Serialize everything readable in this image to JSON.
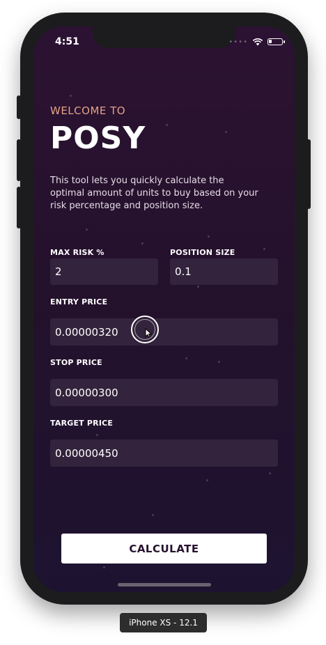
{
  "status_bar": {
    "time": "4:51"
  },
  "header": {
    "welcome": "WELCOME TO",
    "title": "POSY",
    "description": "This tool lets you quickly calculate the optimal amount of units to buy based on your risk percentage and position size."
  },
  "form": {
    "max_risk": {
      "label": "MAX RISK %",
      "value": "2"
    },
    "position_size": {
      "label": "POSITION SIZE",
      "value": "0.1"
    },
    "entry_price": {
      "label": "ENTRY PRICE",
      "value": "0.00000320"
    },
    "stop_price": {
      "label": "STOP PRICE",
      "value": "0.00000300"
    },
    "target_price": {
      "label": "TARGET PRICE",
      "value": "0.00000450"
    }
  },
  "actions": {
    "calculate_label": "CALCULATE"
  },
  "simulator": {
    "device_label": "iPhone XS - 12.1"
  },
  "colors": {
    "accent": "#e3a287",
    "field_bg": "#33233c",
    "background": "#26122e"
  }
}
